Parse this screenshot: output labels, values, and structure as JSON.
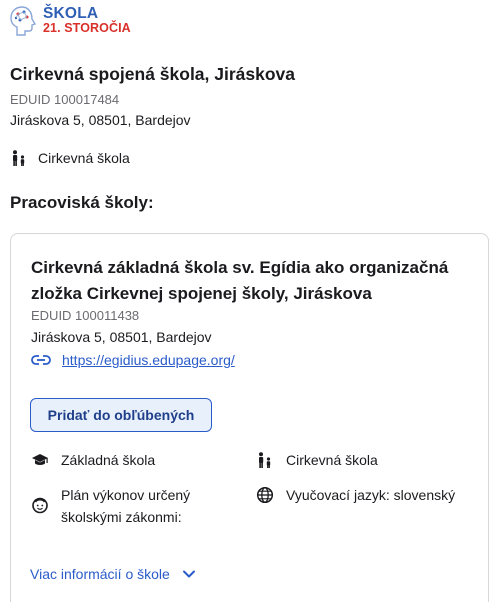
{
  "logo": {
    "line1": "ŠKOLA",
    "line2": "21. STOROČIA"
  },
  "school": {
    "name": "Cirkevná spojená škola, Jiráskova",
    "eduid": "EDUID 100017484",
    "address": "Jiráskova 5, 08501, Bardejov",
    "type": "Cirkevná škola"
  },
  "workplaces": {
    "title": "Pracoviská školy:",
    "items": [
      {
        "name": "Cirkevná základná škola sv. Egídia ako organizačná zložka Cirkevnej spojenej školy, Jiráskova",
        "eduid": "EDUID 100011438",
        "address": "Jiráskova 5, 08501, Bardejov",
        "website": "https://egidius.edupage.org/",
        "favorite_label": "Pridať do obľúbených",
        "level": "Základná škola",
        "founder_type": "Cirkevná škola",
        "plan": "Plán výkonov určený školskými zákonmi:",
        "language": "Vyučovací jazyk: slovenský",
        "more_label": "Viac informácií o škole"
      }
    ]
  },
  "colors": {
    "link": "#2a5cc9",
    "logo_blue": "#2f5fb5",
    "logo_red": "#d9302a"
  }
}
